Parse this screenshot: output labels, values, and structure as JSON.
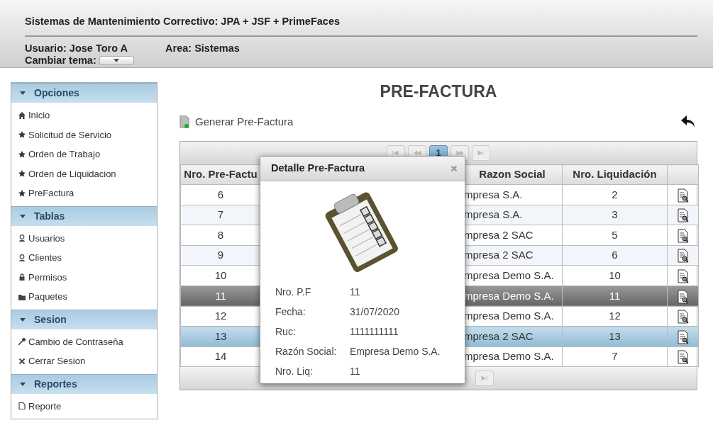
{
  "header": {
    "title": "Sistemas de Mantenimiento Correctivo: JPA + JSF + PrimeFaces",
    "user": "Usuario: Jose Toro A",
    "area": "Area: Sistemas",
    "theme_label": "Cambiar tema:"
  },
  "sidebar": [
    {
      "title": "Opciones",
      "expanded": true,
      "items": [
        {
          "label": "Inicio",
          "kind": "home"
        },
        {
          "label": "Solicitud de Servicio",
          "kind": "star"
        },
        {
          "label": "Orden de Trabajo",
          "kind": "star"
        },
        {
          "label": "Orden de Liquidacion",
          "kind": "star"
        },
        {
          "label": "PreFactura",
          "kind": "star"
        }
      ]
    },
    {
      "title": "Tablas",
      "expanded": true,
      "items": [
        {
          "label": "Usuarios",
          "kind": "user"
        },
        {
          "label": "Clientes",
          "kind": "user"
        },
        {
          "label": "Permisos",
          "kind": "lock"
        },
        {
          "label": "Paquetes",
          "kind": "folder"
        }
      ]
    },
    {
      "title": "Sesion",
      "expanded": true,
      "items": [
        {
          "label": "Cambio de Contraseña",
          "kind": "key"
        },
        {
          "label": "Cerrar Sesion",
          "kind": "close"
        }
      ]
    },
    {
      "title": "Reportes",
      "expanded": true,
      "items": [
        {
          "label": "Reporte",
          "kind": "page"
        }
      ]
    }
  ],
  "page_title": "PRE-FACTURA",
  "generate_button": "Generar Pre-Factura",
  "paginator": {
    "pages": [
      {
        "label": "1",
        "selected": true
      }
    ]
  },
  "table": {
    "columns": [
      "Nro. Pre-Factu",
      "Razon Social",
      "Nro. Liquidación"
    ],
    "rows": [
      {
        "cells": [
          "6",
          "mpresa S.A.",
          "2"
        ],
        "selected": false,
        "hovered": false
      },
      {
        "cells": [
          "7",
          "mpresa S.A.",
          "3"
        ],
        "selected": false,
        "hovered": false
      },
      {
        "cells": [
          "8",
          "mpresa 2 SAC",
          "5"
        ],
        "selected": false,
        "hovered": false
      },
      {
        "cells": [
          "9",
          "mpresa 2 SAC",
          "6"
        ],
        "selected": false,
        "hovered": false
      },
      {
        "cells": [
          "10",
          "mpresa Demo S.A.",
          "10"
        ],
        "selected": false,
        "hovered": false
      },
      {
        "cells": [
          "11",
          "mpresa Demo S.A.",
          "11"
        ],
        "selected": true,
        "hovered": false
      },
      {
        "cells": [
          "12",
          "mpresa Demo S.A.",
          "12"
        ],
        "selected": false,
        "hovered": false
      },
      {
        "cells": [
          "13",
          "mpresa 2 SAC",
          "13"
        ],
        "selected": false,
        "hovered": true
      },
      {
        "cells": [
          "14",
          "mpresa Demo S.A.",
          "7"
        ],
        "selected": false,
        "hovered": false
      }
    ]
  },
  "dialog": {
    "title": "Detalle Pre-Factura",
    "fields": [
      {
        "label": "Nro. P.F",
        "value": "11"
      },
      {
        "label": "Fecha:",
        "value": "31/07/2020"
      },
      {
        "label": "Ruc:",
        "value": "1111111111"
      },
      {
        "label": "Razón Social:",
        "value": "Empresa Demo S.A."
      },
      {
        "label": "Nro. Liq:",
        "value": "11"
      }
    ]
  }
}
